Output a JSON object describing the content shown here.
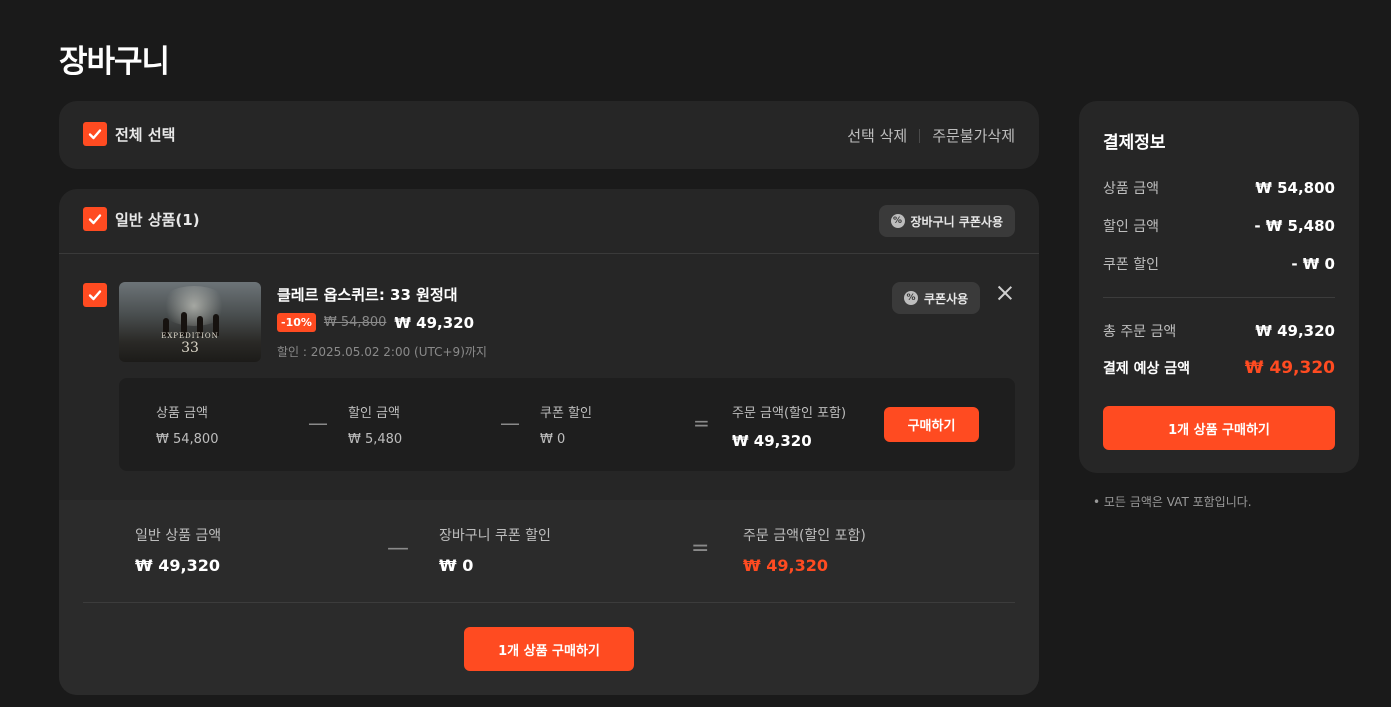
{
  "page": {
    "title": "장바구니"
  },
  "select_bar": {
    "select_all_label": "전체 선택",
    "delete_selected": "선택 삭제",
    "delete_unavailable": "주문불가삭제"
  },
  "general_section": {
    "title": "일반 상품(1)",
    "cart_coupon_label": "장바구니 쿠폰사용"
  },
  "item": {
    "title": "클레르 옵스퀴르: 33 원정대",
    "discount_badge": "-10%",
    "original_price": "₩ 54,800",
    "sale_price": "₩ 49,320",
    "discount_until": "할인 : 2025.05.02 2:00 (UTC+9)까지",
    "coupon_label": "쿠폰사용",
    "thumbnail_logo": "EXPEDITION",
    "thumbnail_number": "33",
    "calc": {
      "product_label": "상품 금액",
      "product_value": "₩ 54,800",
      "discount_label": "할인 금액",
      "discount_value": "₩ 5,480",
      "coupon_label": "쿠폰 할인",
      "coupon_value": "₩ 0",
      "order_label": "주문 금액(할인 포함)",
      "order_value": "₩ 49,320",
      "op_minus": "—",
      "op_equals": "="
    },
    "buy_label": "구매하기"
  },
  "section_summary": {
    "general_label": "일반 상품 금액",
    "general_value": "₩ 49,320",
    "cart_coupon_label": "장바구니 쿠폰 할인",
    "cart_coupon_value": "₩ 0",
    "order_label": "주문 금액(할인 포함)",
    "order_value": "₩ 49,320",
    "buy_label": "1개 상품 구매하기"
  },
  "payment": {
    "title": "결제정보",
    "product_label": "상품 금액",
    "product_value": "₩ 54,800",
    "discount_label": "할인 금액",
    "discount_value": "- ₩ 5,480",
    "coupon_label": "쿠폰 할인",
    "coupon_value": "- ₩ 0",
    "total_label": "총 주문 금액",
    "total_value": "₩ 49,320",
    "expected_label": "결제 예상 금액",
    "expected_value": "₩ 49,320",
    "buy_label": "1개 상품 구매하기"
  },
  "vat_note": "• 모든 금액은 VAT 포함입니다.",
  "colors": {
    "accent": "#ff4b21",
    "background": "#1a1a1a",
    "card": "#262626"
  },
  "icons": {
    "checkbox": "check-icon",
    "coupon": "coupon-icon",
    "remove": "close-icon"
  }
}
